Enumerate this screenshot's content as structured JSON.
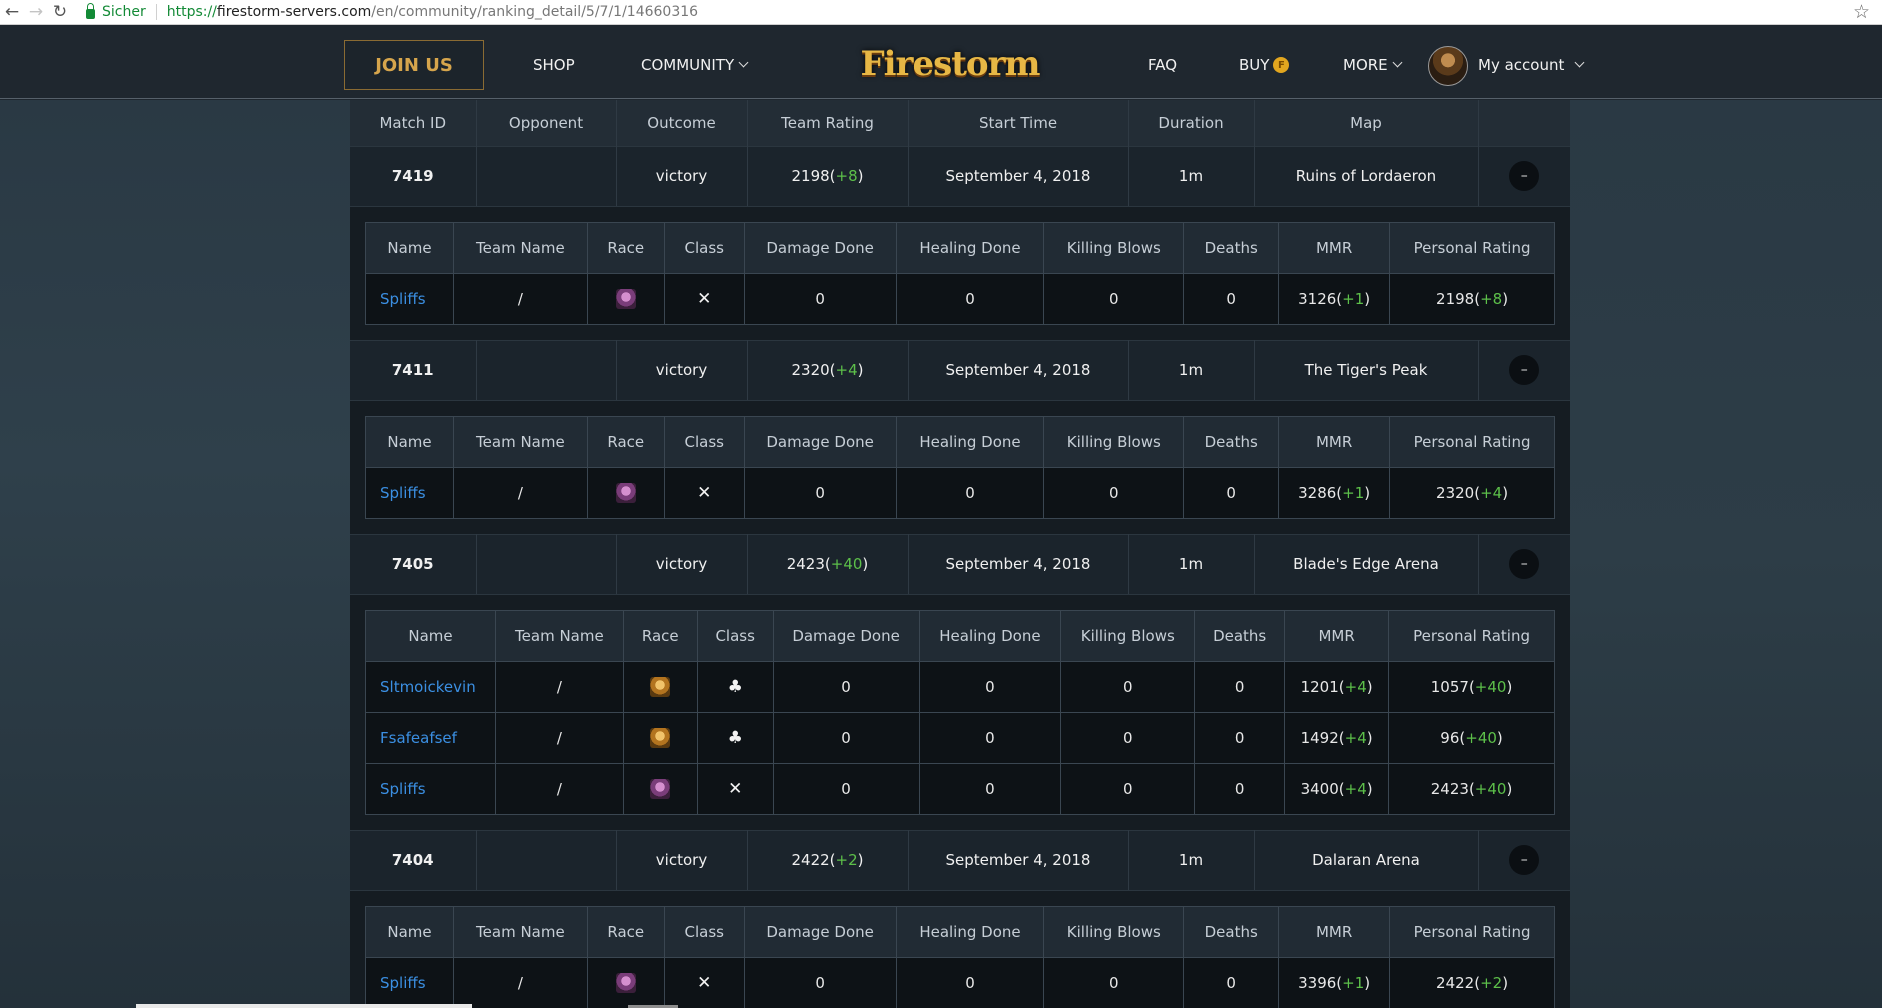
{
  "browser": {
    "secure_label": "Sicher",
    "url_scheme": "https://",
    "url_host": "firestorm-servers.com",
    "url_path": "/en/community/ranking_detail/5/7/1/14660316"
  },
  "header": {
    "join_label": "JOIN US",
    "shop_label": "SHOP",
    "community_label": "COMMUNITY",
    "logo_text": "Firestorm",
    "faq_label": "FAQ",
    "buy_label": "BUY",
    "more_label": "MORE",
    "account_label": "My account"
  },
  "columns": [
    "Match ID",
    "Opponent",
    "Outcome",
    "Team Rating",
    "Start Time",
    "Duration",
    "Map"
  ],
  "detail_columns": [
    "Name",
    "Team Name",
    "Race",
    "Class",
    "Damage Done",
    "Healing Done",
    "Killing Blows",
    "Deaths",
    "MMR",
    "Personal Rating"
  ],
  "toggle_label": "–",
  "matches": [
    {
      "id": "7419",
      "opponent": "",
      "outcome": "victory",
      "rating": "2198",
      "rating_delta": "+8",
      "start": "September 4, 2018",
      "duration": "1m",
      "map": "Ruins of Lordaeron",
      "players": [
        {
          "name": "Spliffs",
          "team": "/",
          "race": "undead",
          "class": "rogue",
          "damage": "0",
          "healing": "0",
          "kb": "0",
          "deaths": "0",
          "mmr": "3126",
          "mmr_delta": "+1",
          "pr": "2198",
          "pr_delta": "+8"
        }
      ]
    },
    {
      "id": "7411",
      "opponent": "",
      "outcome": "victory",
      "rating": "2320",
      "rating_delta": "+4",
      "start": "September 4, 2018",
      "duration": "1m",
      "map": "The Tiger's Peak",
      "players": [
        {
          "name": "Spliffs",
          "team": "/",
          "race": "undead",
          "class": "rogue",
          "damage": "0",
          "healing": "0",
          "kb": "0",
          "deaths": "0",
          "mmr": "3286",
          "mmr_delta": "+1",
          "pr": "2320",
          "pr_delta": "+4"
        }
      ]
    },
    {
      "id": "7405",
      "opponent": "",
      "outcome": "victory",
      "rating": "2423",
      "rating_delta": "+40",
      "start": "September 4, 2018",
      "duration": "1m",
      "map": "Blade's Edge Arena",
      "players": [
        {
          "name": "Sltmoickevin",
          "team": "/",
          "race": "human",
          "class": "priest",
          "damage": "0",
          "healing": "0",
          "kb": "0",
          "deaths": "0",
          "mmr": "1201",
          "mmr_delta": "+4",
          "pr": "1057",
          "pr_delta": "+40"
        },
        {
          "name": "Fsafeafsef",
          "team": "/",
          "race": "human",
          "class": "priest",
          "damage": "0",
          "healing": "0",
          "kb": "0",
          "deaths": "0",
          "mmr": "1492",
          "mmr_delta": "+4",
          "pr": "96",
          "pr_delta": "+40"
        },
        {
          "name": "Spliffs",
          "team": "/",
          "race": "undead",
          "class": "rogue",
          "damage": "0",
          "healing": "0",
          "kb": "0",
          "deaths": "0",
          "mmr": "3400",
          "mmr_delta": "+4",
          "pr": "2423",
          "pr_delta": "+40"
        }
      ]
    },
    {
      "id": "7404",
      "opponent": "",
      "outcome": "victory",
      "rating": "2422",
      "rating_delta": "+2",
      "start": "September 4, 2018",
      "duration": "1m",
      "map": "Dalaran Arena",
      "players": [
        {
          "name": "Spliffs",
          "team": "/",
          "race": "undead",
          "class": "rogue",
          "damage": "0",
          "healing": "0",
          "kb": "0",
          "deaths": "0",
          "mmr": "3396",
          "mmr_delta": "+1",
          "pr": "2422",
          "pr_delta": "+2"
        }
      ]
    }
  ],
  "colors": {
    "positive": "#5dc04a",
    "link": "#3b8fe2",
    "accent": "#d6a54c"
  }
}
